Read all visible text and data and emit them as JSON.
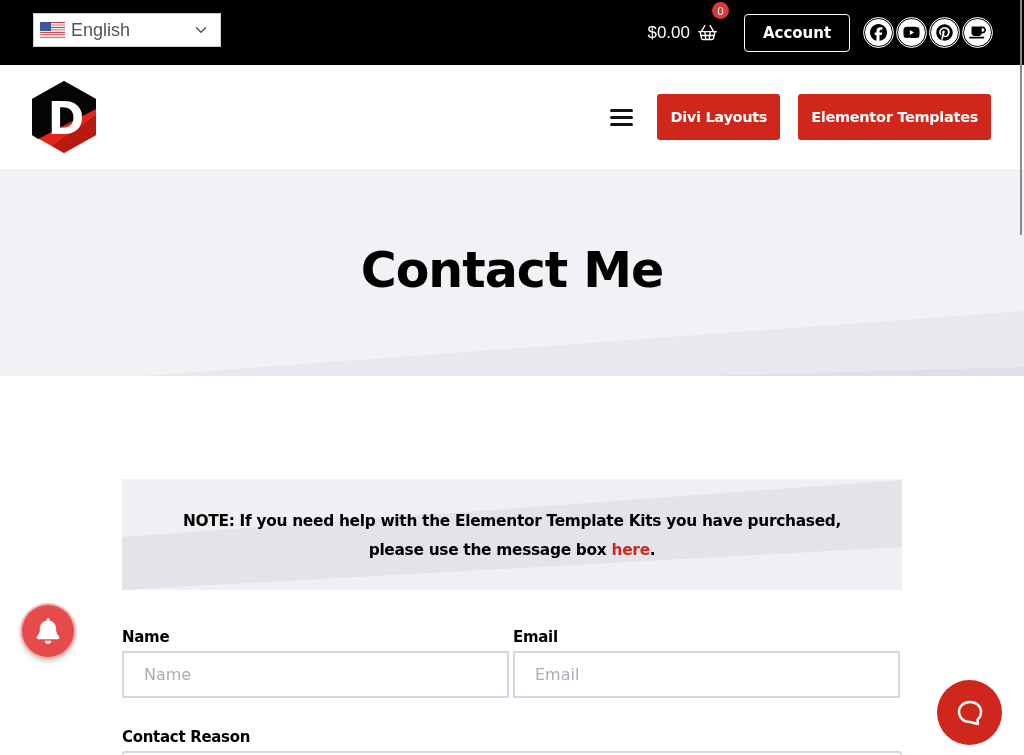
{
  "top_bar": {
    "language_select": {
      "value": "English"
    },
    "cart": {
      "total": "$0.00",
      "count": "0"
    },
    "account_button": "Account"
  },
  "header": {
    "logo": {
      "letter": "D"
    },
    "nav_buttons": [
      "Divi Layouts",
      "Elementor Templates"
    ]
  },
  "hero": {
    "title": "Contact Me"
  },
  "note": {
    "text": "NOTE: If you need help with the Elementor Template Kits you have purchased, please use the message box",
    "link": "here",
    "end": "."
  },
  "form": {
    "fields": [
      {
        "label": "Name",
        "placeholder": "Name"
      },
      {
        "label": "Email",
        "placeholder": "Email"
      }
    ],
    "contact_reason": {
      "label": "Contact Reason"
    }
  }
}
